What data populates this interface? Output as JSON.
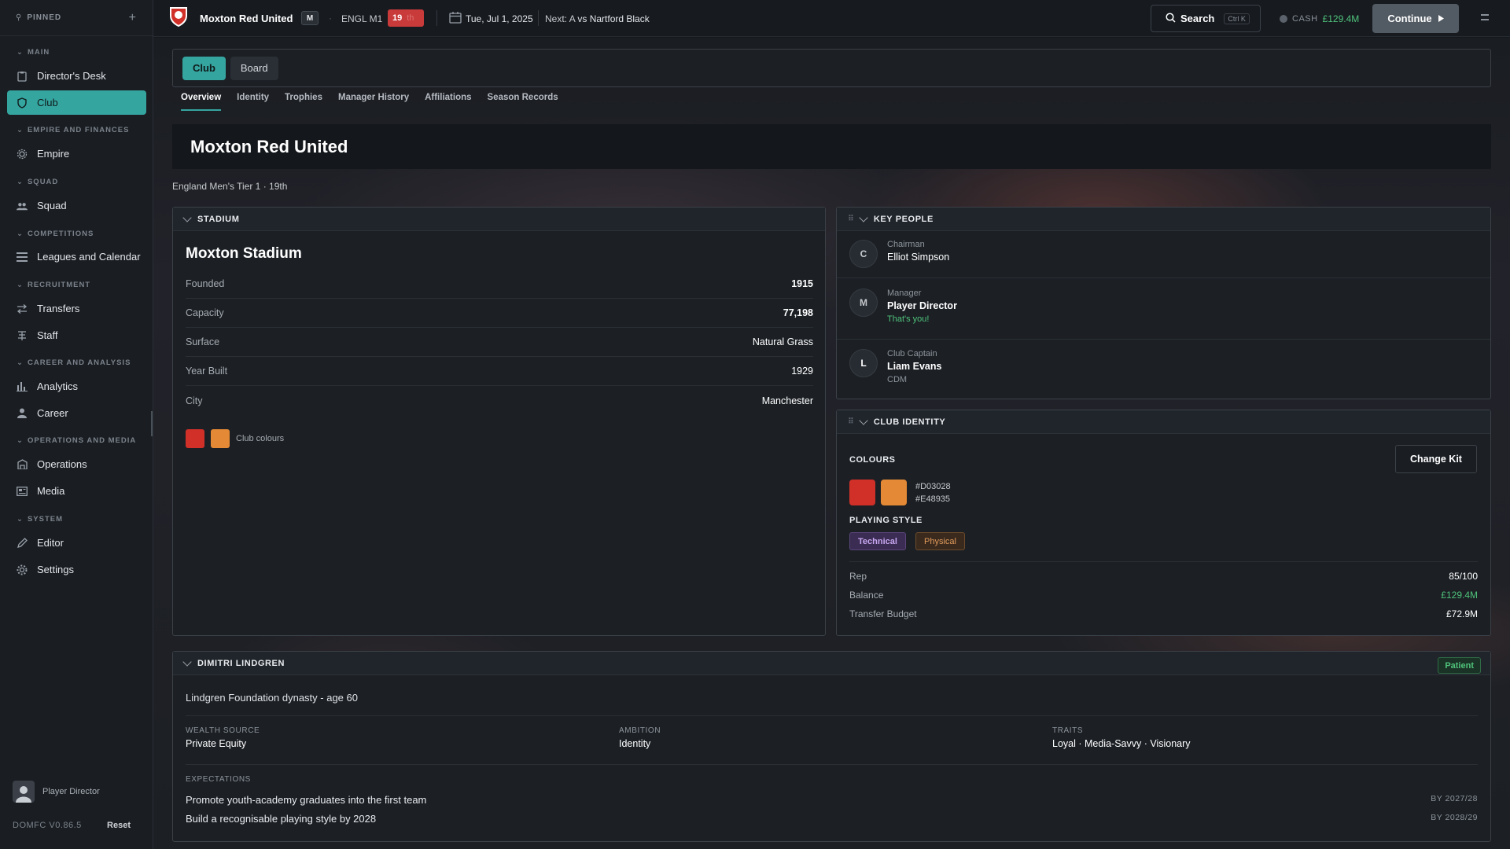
{
  "sidebar": {
    "pinned_label": "PINNED",
    "sections": {
      "main": "MAIN",
      "empire": "EMPIRE AND FINANCES",
      "squad": "SQUAD",
      "competitions": "COMPETITIONS",
      "recruitment": "RECRUITMENT",
      "career": "CAREER AND ANALYSIS",
      "operations": "OPERATIONS AND MEDIA",
      "system": "SYSTEM"
    },
    "items": {
      "directors_desk": "Director's Desk",
      "club": "Club",
      "empire": "Empire",
      "squad": "Squad",
      "leagues": "Leagues and Calendar",
      "transfers": "Transfers",
      "staff": "Staff",
      "analytics": "Analytics",
      "career": "Career",
      "operations": "Operations",
      "media": "Media",
      "editor": "Editor",
      "settings": "Settings"
    },
    "user_name": "Player Director",
    "version": "DOMFC V0.86.5",
    "reset_label": "Reset"
  },
  "topbar": {
    "club_name": "Moxton Red United",
    "badge": "M",
    "league": "ENGL M1",
    "rank": "19",
    "rank_suffix": "th",
    "date": "Tue, Jul 1, 2025",
    "next_label": "Next:",
    "next_venue": "A",
    "next_opponent": "vs Nartford Black",
    "search_label": "Search",
    "search_shortcut": "Ctrl K",
    "cash_label": "CASH",
    "cash_value": "£129.4M",
    "continue_label": "Continue"
  },
  "tabs": [
    "Club",
    "Board"
  ],
  "subtabs": [
    "Overview",
    "Identity",
    "Trophies",
    "Manager History",
    "Affiliations",
    "Season Records"
  ],
  "hero": {
    "title": "Moxton Red United",
    "subtitle": "England Men's Tier 1 · 19th"
  },
  "stadium": {
    "heading": "STADIUM",
    "name": "Moxton Stadium",
    "rows": [
      {
        "k": "Founded",
        "v": "1915"
      },
      {
        "k": "Capacity",
        "v": "77,198"
      },
      {
        "k": "Surface",
        "v": "Natural Grass"
      },
      {
        "k": "Year Built",
        "v": "1929"
      },
      {
        "k": "City",
        "v": "Manchester"
      }
    ],
    "colours_label": "Club colours",
    "colour1": "#D03028",
    "colour2": "#E48935"
  },
  "key_people": {
    "heading": "KEY PEOPLE",
    "people": [
      {
        "initial": "C",
        "role": "Chairman",
        "name": "Elliot Simpson",
        "extra": ""
      },
      {
        "initial": "M",
        "role": "Manager",
        "name": "Player Director",
        "extra": "That's you!"
      },
      {
        "initial": "L",
        "role": "Club Captain",
        "name": "Liam Evans",
        "extra": "CDM"
      }
    ]
  },
  "club_identity": {
    "heading": "CLUB IDENTITY",
    "colours_label": "COLOURS",
    "change_kit": "Change Kit",
    "hex1": "#D03028",
    "hex2": "#E48935",
    "playing_style_label": "PLAYING STYLE",
    "styles": [
      "Technical",
      "Physical"
    ],
    "rows": [
      {
        "k": "Rep",
        "v": "85/100"
      },
      {
        "k": "Balance",
        "v": "£129.4M"
      },
      {
        "k": "Transfer Budget",
        "v": "£72.9M"
      }
    ]
  },
  "owner": {
    "heading": "DIMITRI LINDGREN",
    "temperament": "Patient",
    "dynasty": "Lindgren Foundation dynasty - age 60",
    "wealth_label": "WEALTH SOURCE",
    "wealth_value": "Private Equity",
    "ambition_label": "AMBITION",
    "ambition_value": "Identity",
    "traits_label": "TRAITS",
    "traits_value": "Loyal · Media-Savvy · Visionary",
    "expectations_label": "EXPECTATIONS",
    "expectations": [
      {
        "text": "Promote youth-academy graduates into the first team",
        "by": "BY 2027/28"
      },
      {
        "text": "Build a recognisable playing style by 2028",
        "by": "BY 2028/29"
      }
    ]
  },
  "colors": {
    "accent": "#35A5A0",
    "club_red": "#D03028",
    "club_orange": "#E48935",
    "positive": "#4FC27A"
  }
}
